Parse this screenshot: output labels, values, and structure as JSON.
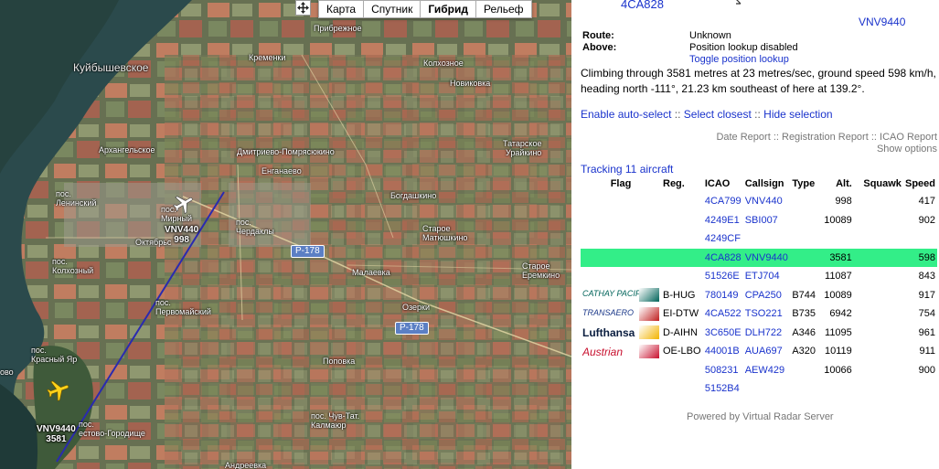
{
  "map": {
    "map_types": [
      {
        "label": "Карта",
        "active": false
      },
      {
        "label": "Спутник",
        "active": false
      },
      {
        "label": "Гибрид",
        "active": true
      },
      {
        "label": "Рельеф",
        "active": false
      }
    ],
    "places": {
      "kuybyshevskoe": "Куйбышевское",
      "pribrezhnoe": "Прибрежное",
      "kremenki": "Кременки",
      "kolkhoznoe": "Колхозное",
      "novikovka": "Новиковка",
      "arkhangelskoe": "Архангельское",
      "dmitrievo": "Дмитриево-Помрясюкино",
      "tatarskoe_uraikino": "Татарское Урайкино",
      "tatarskoe": "Татарское",
      "uraikino": "Урайкино",
      "enganaevo": "Енганаево",
      "pos_leninsky": "пос.\nЛенинский",
      "mirny": "пос.\nМирный",
      "bogdashkino": "Богдашкино",
      "chardakly": "пос.\nЧердаклы",
      "oktyabrsky": "Октябрьс",
      "staroe_matyushkino": "Старое\nМатюшкино",
      "malaevka": "Малаевка",
      "staroe_eremkino": "Старое\nЕремкино",
      "kolkhozny": "пос.\nКолхозный",
      "pervomaysky": "пос.\nПервомайский",
      "ozerki": "Озерки",
      "popovka": "Поповка",
      "krasny_yar": "пос.\nКрасный Яр",
      "ostrov_edge": "ово",
      "chuv_tat": "пос. Чув-Тат.\nКалмаюр",
      "gorodische": "пос.\nестово-Городище",
      "andreevka": "Андреевка"
    },
    "roads": [
      "Р-178",
      "Р-178"
    ],
    "aircraft_labels": [
      {
        "callsign": "VNV440",
        "alt": "998"
      },
      {
        "callsign": "VNV9440",
        "alt": "3581"
      }
    ]
  },
  "panel": {
    "selected_icao": "4CA828",
    "selected_callsign": "VNV9440",
    "info": [
      {
        "k": "Route:",
        "v": "Unknown"
      },
      {
        "k": "Above:",
        "v": "Position lookup disabled"
      }
    ],
    "toggle_lookup": "Toggle position lookup",
    "description": "Climbing through 3581 metres at 23 metres/sec, ground speed 598 km/h, heading north -111°, 21.23 km southeast of here at 139.2°.",
    "actions": {
      "auto_select": "Enable auto-select",
      "select_closest": "Select closest",
      "hide_selection": "Hide selection",
      "sep": "::"
    },
    "reports": {
      "date": "Date Report",
      "registration": "Registration Report",
      "icao": "ICAO Report",
      "show_options": "Show options",
      "sep": "::"
    },
    "tracking": "Tracking 11 aircraft",
    "table": {
      "headers": {
        "flag": "Flag",
        "reg": "Reg.",
        "icao": "ICAO",
        "callsign": "Callsign",
        "type": "Type",
        "alt": "Alt.",
        "squawk": "Squawk",
        "speed": "Speed"
      },
      "rows": [
        {
          "flag": "",
          "reg": "",
          "icao": "4CA799",
          "callsign": "VNV440",
          "type": "",
          "alt": "998",
          "squawk": "",
          "speed": "417",
          "hl": false
        },
        {
          "flag": "",
          "reg": "",
          "icao": "4249E1",
          "callsign": "SBI007",
          "type": "",
          "alt": "10089",
          "squawk": "",
          "speed": "902",
          "hl": false
        },
        {
          "flag": "",
          "reg": "",
          "icao": "4249CF",
          "callsign": "",
          "type": "",
          "alt": "",
          "squawk": "",
          "speed": "",
          "hl": false
        },
        {
          "flag": "",
          "reg": "",
          "icao": "4CA828",
          "callsign": "VNV9440",
          "type": "",
          "alt": "3581",
          "squawk": "",
          "speed": "598",
          "hl": true
        },
        {
          "flag": "",
          "reg": "",
          "icao": "51526E",
          "callsign": "ETJ704",
          "type": "",
          "alt": "11087",
          "squawk": "",
          "speed": "843",
          "hl": false
        },
        {
          "flag": "CATHAY PACIFIC",
          "reg": "B-HUG",
          "icao": "780149",
          "callsign": "CPA250",
          "type": "B744",
          "alt": "10089",
          "squawk": "",
          "speed": "917",
          "hl": false
        },
        {
          "flag": "TRANSAERO",
          "reg": "EI-DTW",
          "icao": "4CA522",
          "callsign": "TSO221",
          "type": "B735",
          "alt": "6942",
          "squawk": "",
          "speed": "754",
          "hl": false
        },
        {
          "flag": "Lufthansa",
          "reg": "D-AIHN",
          "icao": "3C650E",
          "callsign": "DLH722",
          "type": "A346",
          "alt": "11095",
          "squawk": "",
          "speed": "961",
          "hl": false
        },
        {
          "flag": "Austrian",
          "reg": "OE-LBO",
          "icao": "44001B",
          "callsign": "AUA697",
          "type": "A320",
          "alt": "10119",
          "squawk": "",
          "speed": "911",
          "hl": false
        },
        {
          "flag": "",
          "reg": "",
          "icao": "508231",
          "callsign": "AEW429",
          "type": "",
          "alt": "10066",
          "squawk": "",
          "speed": "900",
          "hl": false
        },
        {
          "flag": "",
          "reg": "",
          "icao": "5152B4",
          "callsign": "",
          "type": "",
          "alt": "",
          "squawk": "",
          "speed": "",
          "hl": false
        }
      ]
    },
    "powered_by": "Powered by Virtual Radar Server"
  }
}
